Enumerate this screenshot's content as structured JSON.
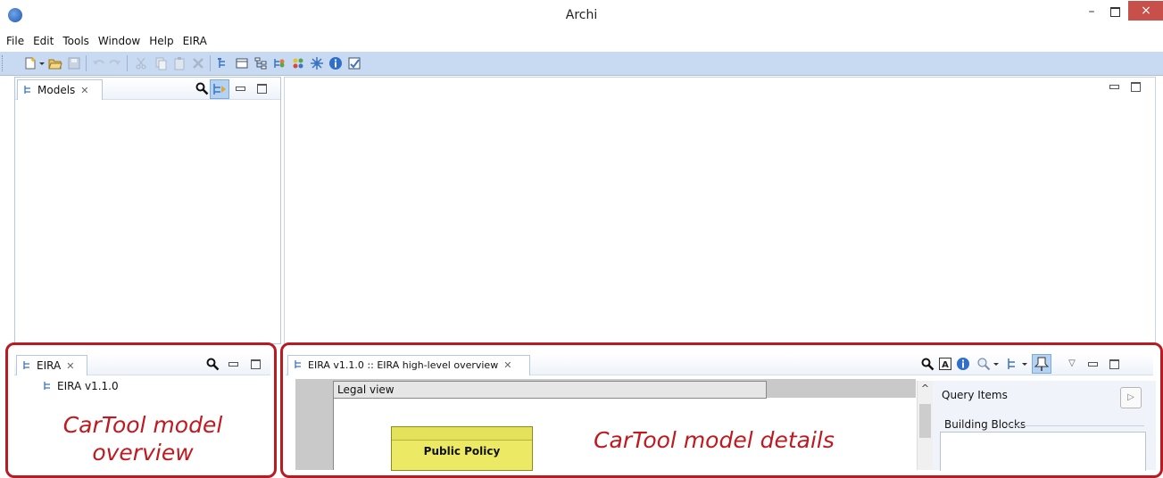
{
  "window": {
    "title": "Archi",
    "minimize_glyph": "–",
    "close_glyph": "×"
  },
  "menu": [
    "File",
    "Edit",
    "Tools",
    "Window",
    "Help",
    "EIRA"
  ],
  "toolbar_icons": [
    "new-icon",
    "dropdown-arrow-icon",
    "open-folder-icon",
    "save-icon",
    "undo-icon",
    "redo-icon",
    "cut-icon",
    "copy-icon",
    "paste-icon",
    "delete-icon",
    "models-tree-icon",
    "properties-icon",
    "outline-icon",
    "navigator-icon",
    "palette-icon",
    "viewpoint-icon",
    "info-icon",
    "validator-icon"
  ],
  "models_panel": {
    "tab_label": "Models"
  },
  "eira_panel": {
    "tab_label": "EIRA",
    "tree_item": "EIRA v1.1.0"
  },
  "details_panel": {
    "tab_label": "EIRA v1.1.0 :: EIRA high-level overview",
    "legal_view_label": "Legal view",
    "element_label": "Public Policy",
    "query_items_label": "Query Items",
    "building_blocks_label": "Building Blocks"
  },
  "annotations": {
    "overview_text": "CarTool model overview",
    "details_text": "CarTool model details",
    "color": "#b81c22"
  },
  "colors": {
    "toolbar_bg": "#c8daf1",
    "close_button": "#c7504b",
    "element_fill": "#ecea64"
  }
}
